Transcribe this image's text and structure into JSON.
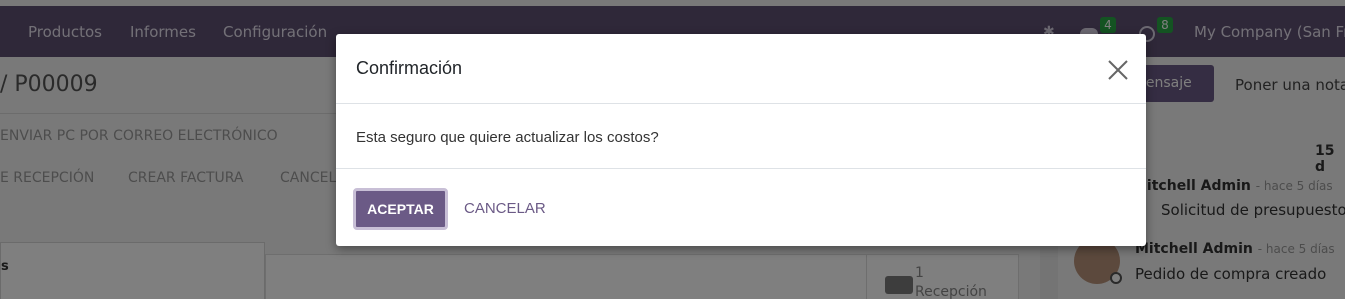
{
  "topbar": {
    "menu": [
      "Productos",
      "Informes",
      "Configuración"
    ],
    "icons": [
      "bug-icon",
      "chat-icon",
      "activity-clock-icon"
    ],
    "messages_count": "4",
    "activities_count": "8",
    "company": "My Company (San Francisco)"
  },
  "background": {
    "record_title": "/ P00009",
    "actions_row1": [
      "ENVIAR PC POR CORREO ELECTRÓNICO"
    ],
    "actions_row2": [
      "E RECEPCIÓN",
      "CREAR FACTURA",
      "CANCELAR"
    ],
    "card_label": "s",
    "smart_button": {
      "count": "1",
      "label": "Recepción"
    },
    "chatter": {
      "send_message": "nensaje",
      "log_note": "Poner una nota",
      "date_separator": "15 d",
      "messages": [
        {
          "author": "Mitchell Admin",
          "time": "- hace 5 días",
          "body": "Solicitud de presupuesto"
        },
        {
          "author": "Mitchell Admin",
          "time": "- hace 5 días",
          "body": "Pedido de compra creado"
        }
      ]
    }
  },
  "dialog": {
    "title": "Confirmación",
    "body": "Esta seguro que quiere actualizar los costos?",
    "confirm_label": "ACEPTAR",
    "cancel_label": "CANCELAR",
    "close_icon": "close-icon"
  },
  "colors": {
    "navbar": "#5e5172",
    "primary": "#6b5a86",
    "badge": "#28a745"
  }
}
